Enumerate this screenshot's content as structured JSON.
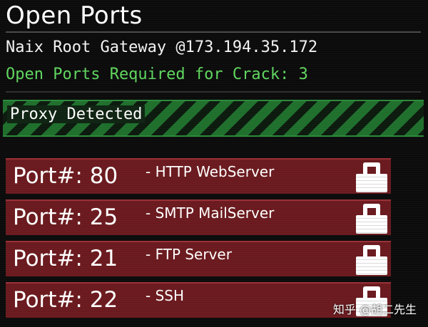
{
  "window": {
    "title": "Open Ports"
  },
  "target": {
    "gateway": "Naix Root Gateway @173.194.35.172",
    "requirement": "Open Ports Required for Crack: 3"
  },
  "proxy": {
    "label": "Proxy Detected"
  },
  "ports": [
    {
      "label": "Port#: 80",
      "service": "- HTTP WebServer",
      "locked": true
    },
    {
      "label": "Port#: 25",
      "service": "- SMTP MailServer",
      "locked": true
    },
    {
      "label": "Port#: 21",
      "service": "- FTP Server",
      "locked": true
    },
    {
      "label": "Port#: 22",
      "service": "- SSH",
      "locked": true
    }
  ],
  "watermark": "知乎 @胡二先生",
  "colors": {
    "background": "#0b0b0b",
    "accent_green": "#5fd65f",
    "proxy_stripe": "#1f6f2c",
    "port_row": "#6a1a1e"
  }
}
